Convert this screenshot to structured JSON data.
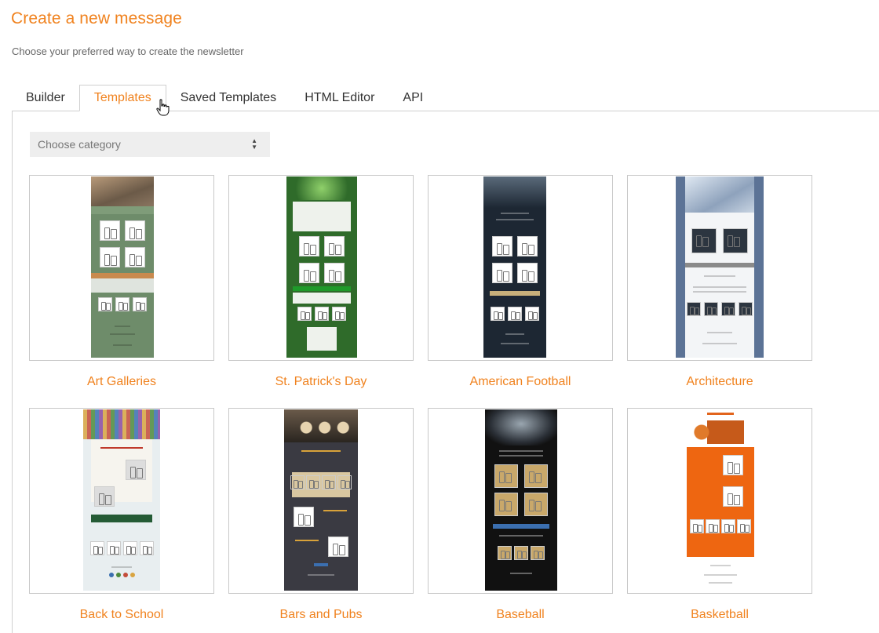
{
  "header": {
    "title": "Create a new message",
    "subtitle": "Choose your preferred way to create the newsletter"
  },
  "tabs": [
    {
      "label": "Builder",
      "active": false
    },
    {
      "label": "Templates",
      "active": true
    },
    {
      "label": "Saved Templates",
      "active": false
    },
    {
      "label": "HTML Editor",
      "active": false
    },
    {
      "label": "API",
      "active": false
    }
  ],
  "category_select": {
    "placeholder": "Choose category"
  },
  "templates": [
    {
      "name": "Art Galleries",
      "bg": "#6e8c6a"
    },
    {
      "name": "St. Patrick's Day",
      "bg": "#2f6b2a"
    },
    {
      "name": "American Football",
      "bg": "#1d2733"
    },
    {
      "name": "Architecture",
      "bg": "#5c7396"
    },
    {
      "name": "Back to School",
      "bg": "#e8eef0"
    },
    {
      "name": "Bars and Pubs",
      "bg": "#3a3a42"
    },
    {
      "name": "Baseball",
      "bg": "#111111"
    },
    {
      "name": "Basketball",
      "bg": "#ee6611"
    }
  ],
  "colors": {
    "accent": "#f0821e",
    "border": "#c8c8c8"
  }
}
